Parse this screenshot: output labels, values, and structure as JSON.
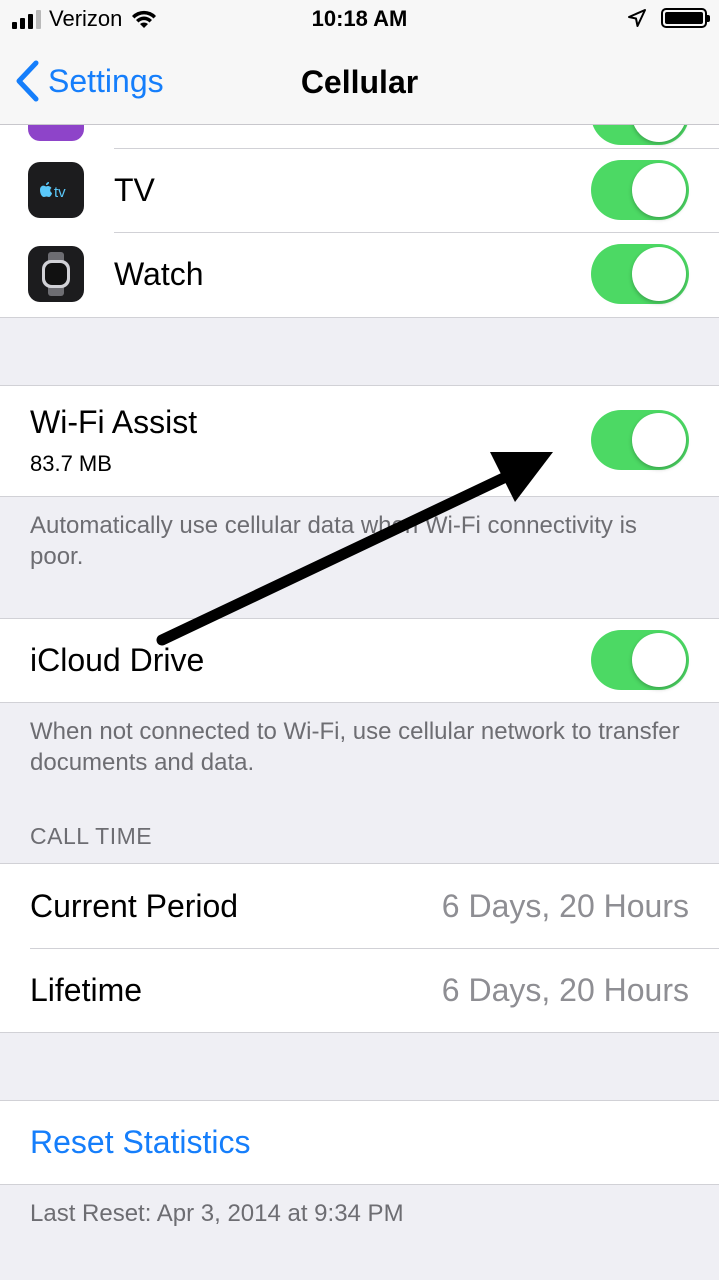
{
  "status": {
    "carrier": "Verizon",
    "time": "10:18 AM"
  },
  "nav": {
    "back_label": "Settings",
    "title": "Cellular"
  },
  "apps": [
    {
      "label": "TV",
      "icon": "apple-tv-icon",
      "icon_text": "tv",
      "enabled": true
    },
    {
      "label": "Watch",
      "icon": "apple-watch-icon",
      "enabled": true
    }
  ],
  "wifi_assist": {
    "label": "Wi-Fi Assist",
    "usage": "83.7 MB",
    "enabled": true,
    "footnote": "Automatically use cellular data when Wi-Fi connectivity is poor."
  },
  "icloud_drive": {
    "label": "iCloud Drive",
    "enabled": true,
    "footnote": "When not connected to Wi-Fi, use cellular network to transfer documents and data."
  },
  "call_time": {
    "header": "CALL TIME",
    "current_period_label": "Current Period",
    "current_period_value": "6 Days, 20 Hours",
    "lifetime_label": "Lifetime",
    "lifetime_value": "6 Days, 20 Hours"
  },
  "reset": {
    "label": "Reset Statistics",
    "last_reset": "Last Reset: Apr 3, 2014 at 9:34 PM"
  },
  "colors": {
    "accent": "#157efb",
    "toggle_on": "#4cd964",
    "background": "#efeff4",
    "purple_icon": "#8e44c9"
  }
}
